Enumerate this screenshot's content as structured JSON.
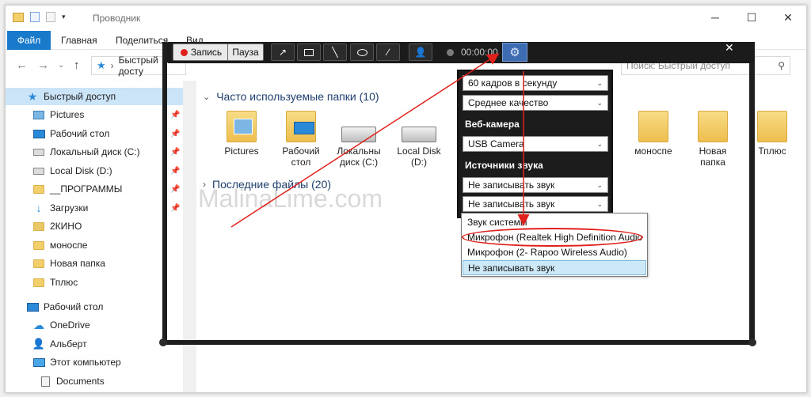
{
  "window": {
    "title": "Проводник"
  },
  "ribbon": {
    "tabs": [
      "Файл",
      "Главная",
      "Поделиться",
      "Вид"
    ]
  },
  "address": {
    "breadcrumb": "Быстрый досту",
    "search_placeholder": "Поиск: Быстрый доступ"
  },
  "sidebar": {
    "items": [
      {
        "label": "Быстрый доступ",
        "icon": "star-icon"
      },
      {
        "label": "Pictures",
        "icon": "pictures-folder-icon"
      },
      {
        "label": "Рабочий стол",
        "icon": "desktop-icon"
      },
      {
        "label": "Локальный диск (C:)",
        "icon": "drive-icon"
      },
      {
        "label": "Local Disk (D:)",
        "icon": "drive-icon"
      },
      {
        "label": "__ПРОГРАММЫ",
        "icon": "folder-icon"
      },
      {
        "label": "Загрузки",
        "icon": "download-icon"
      },
      {
        "label": "2КИНО",
        "icon": "folder-icon"
      },
      {
        "label": "моноспе",
        "icon": "folder-icon"
      },
      {
        "label": "Новая папка",
        "icon": "folder-icon"
      },
      {
        "label": "Тплюс",
        "icon": "folder-icon"
      },
      {
        "label": "Рабочий стол",
        "icon": "desktop-icon"
      },
      {
        "label": "OneDrive",
        "icon": "cloud-icon"
      },
      {
        "label": "Альберт",
        "icon": "user-icon"
      },
      {
        "label": "Этот компьютер",
        "icon": "computer-icon"
      },
      {
        "label": "Documents",
        "icon": "documents-icon"
      }
    ]
  },
  "content": {
    "frequent_header": "Часто используемые папки (10)",
    "recent_header": "Последние файлы (20)",
    "watermark": "MalinaLime.com",
    "tiles": [
      {
        "label1": "Pictures",
        "label2": ""
      },
      {
        "label1": "Рабочий",
        "label2": "стол"
      },
      {
        "label1": "Локальны",
        "label2": "диск (C:)"
      },
      {
        "label1": "Local Disk",
        "label2": "(D:)"
      },
      {
        "label1": "моноспе",
        "label2": ""
      },
      {
        "label1": "Новая",
        "label2": "папка"
      },
      {
        "label1": "Тплюс",
        "label2": ""
      }
    ]
  },
  "recorder": {
    "record_label": "Запись",
    "pause_label": "Пауза",
    "timer": "00:00:00",
    "tools": [
      "arrow-tool-icon",
      "rectangle-tool-icon",
      "line-tool-icon",
      "ellipse-tool-icon",
      "pen-tool-icon",
      "webcam-tool-icon"
    ]
  },
  "settings": {
    "fps": "60 кадров в секунду",
    "quality": "Среднее качество",
    "webcam_label": "Веб-камера",
    "webcam_value": "USB Camera",
    "audio_label": "Источники звука",
    "audio_value1": "Не записывать звук",
    "audio_value2": "Не записывать звук"
  },
  "dropdown": {
    "options": [
      "Звук системы",
      "Микрофон (Realtek High Definition Audio",
      "Микрофон (2- Rapoo Wireless Audio)",
      "Не записывать звук"
    ],
    "selected_index": 3
  },
  "colors": {
    "accent": "#1979ca",
    "annotation_red": "#e0201b",
    "recorder_bg": "#1b1b1b",
    "gear_bg": "#3d6cb2"
  }
}
